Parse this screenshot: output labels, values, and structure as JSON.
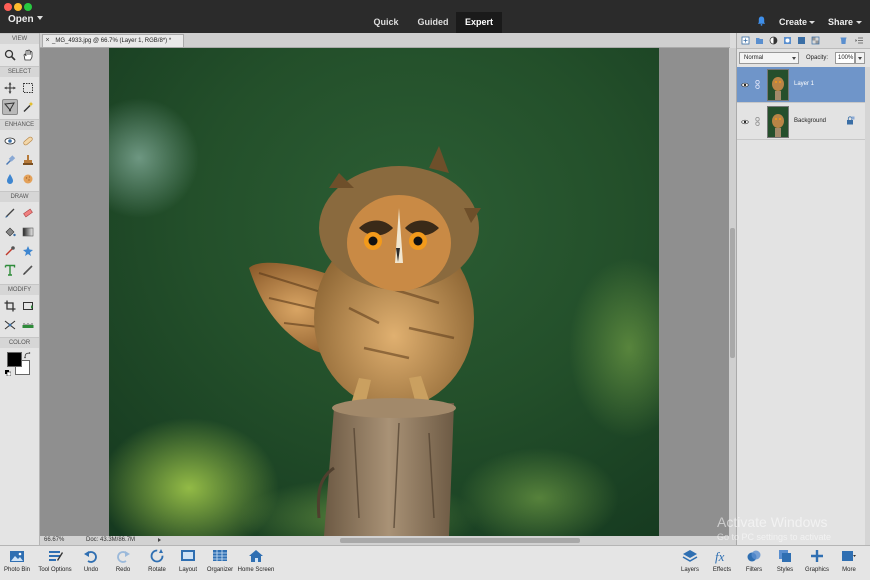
{
  "topbar": {
    "open_label": "Open",
    "modes": [
      "Quick",
      "Guided",
      "Expert"
    ],
    "active_mode": "Expert",
    "create_label": "Create",
    "share_label": "Share"
  },
  "toolbox": {
    "sections": [
      "VIEW",
      "SELECT",
      "ENHANCE",
      "DRAW",
      "MODIFY",
      "COLOR"
    ],
    "tools": {
      "view": [
        "zoom-icon",
        "hand-icon"
      ],
      "select": [
        "move-icon",
        "marquee-icon",
        "lasso-icon",
        "magic-wand-icon"
      ],
      "enhance": [
        "red-eye-icon",
        "spot-healing-icon",
        "smart-brush-icon",
        "clone-stamp-icon",
        "blur-icon",
        "sponge-icon"
      ],
      "draw": [
        "brush-icon",
        "eraser-icon",
        "paint-bucket-icon",
        "gradient-icon",
        "eyedropper-icon",
        "custom-shape-icon",
        "type-icon",
        "pencil-icon"
      ],
      "modify": [
        "crop-icon",
        "recompose-icon",
        "content-aware-move-icon",
        "straighten-icon"
      ]
    },
    "foreground_color": "#000000",
    "background_color": "#ffffff"
  },
  "document": {
    "close_glyph": "×",
    "tab_title": "_MG_4933.jpg @ 66.7% (Layer 1, RGB/8*) *",
    "zoom": "66.67%",
    "doc_size": "Doc: 43.3M/86.7M"
  },
  "layers_panel": {
    "blend_mode": "Normal",
    "opacity_label": "Opacity:",
    "opacity_value": "100%",
    "layers": [
      {
        "name": "Layer 1",
        "selected": true
      },
      {
        "name": "Background",
        "selected": false
      }
    ]
  },
  "bottombar": {
    "left_items": [
      "Photo Bin",
      "Tool Options",
      "Undo",
      "Redo",
      "Rotate",
      "Layout",
      "Organizer",
      "Home Screen"
    ],
    "right_items": [
      "Layers",
      "Effects",
      "Filters",
      "Styles",
      "Graphics",
      "More"
    ]
  },
  "watermark": {
    "line1": "Activate Windows",
    "line2": "Go to PC settings to activate"
  },
  "colors": {
    "accent_selected_layer": "#6f95c9",
    "topbar_bg": "#2b2b2b",
    "bottom_icon_blue": "#2f6fb2"
  }
}
